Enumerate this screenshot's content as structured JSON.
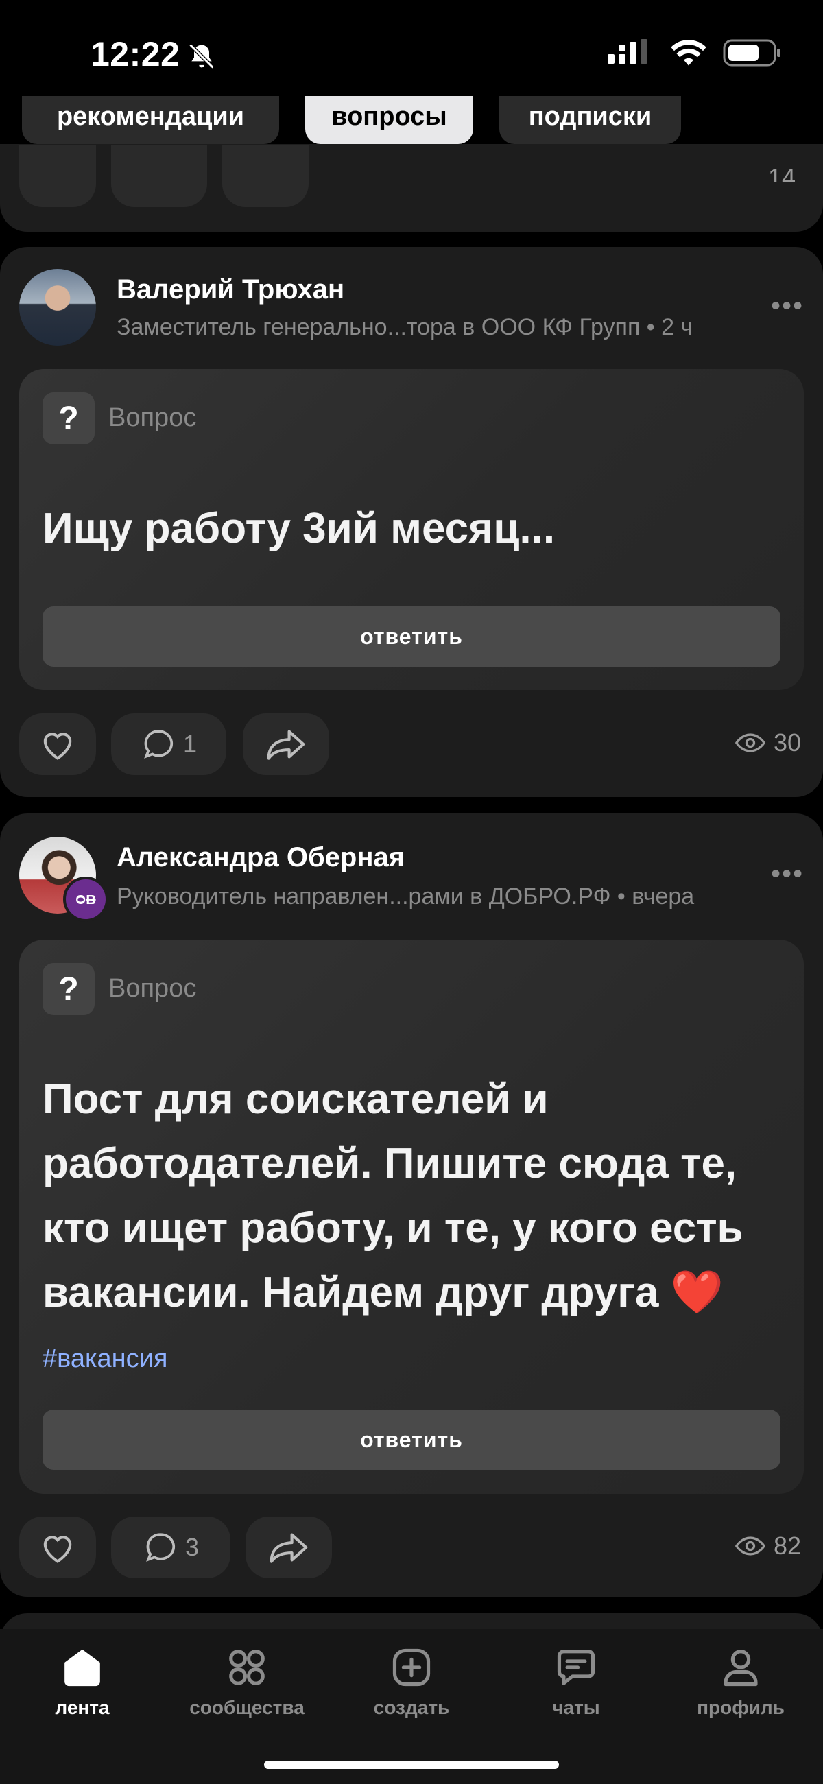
{
  "status_bar": {
    "time": "12:22"
  },
  "filters": [
    {
      "label": "рекомендации",
      "active": false
    },
    {
      "label": "вопросы",
      "active": true
    },
    {
      "label": "подписки",
      "active": false
    }
  ],
  "prev_post": {
    "views": "14"
  },
  "posts": [
    {
      "author": "Валерий Трюхан",
      "subtitle": "Заместитель генерально...тора в ООО КФ Групп • 2 ч",
      "type_label": "Вопрос",
      "question": "Ищу работу 3ий месяц...",
      "hashtag": "",
      "answer_label": "ответить",
      "comments": "1",
      "views": "30"
    },
    {
      "author": "Александра Оберная",
      "subtitle": "Руководитель направлен...рами в ДОБРО.РФ • вчера",
      "type_label": "Вопрос",
      "question": "Пост для соискателей и работодателей. Пишите сюда те, кто ищет работу, и те, у кого есть вакансии. Найдем друг друга ❤️",
      "hashtag": "#вакансия",
      "answer_label": "ответить",
      "comments": "3",
      "views": "82",
      "badge": "ᴑᴃ"
    }
  ],
  "tabs": [
    {
      "label": "лента",
      "icon": "home-icon",
      "active": true
    },
    {
      "label": "сообщества",
      "icon": "grid-icon",
      "active": false
    },
    {
      "label": "создать",
      "icon": "plus-square-icon",
      "active": false
    },
    {
      "label": "чаты",
      "icon": "chat-icon",
      "active": false
    },
    {
      "label": "профиль",
      "icon": "profile-icon",
      "active": false
    }
  ],
  "colors": {
    "background": "#000000",
    "card": "#1d1d1d",
    "hashtag": "#8fb1ff",
    "heart": "#ff3b3b"
  }
}
